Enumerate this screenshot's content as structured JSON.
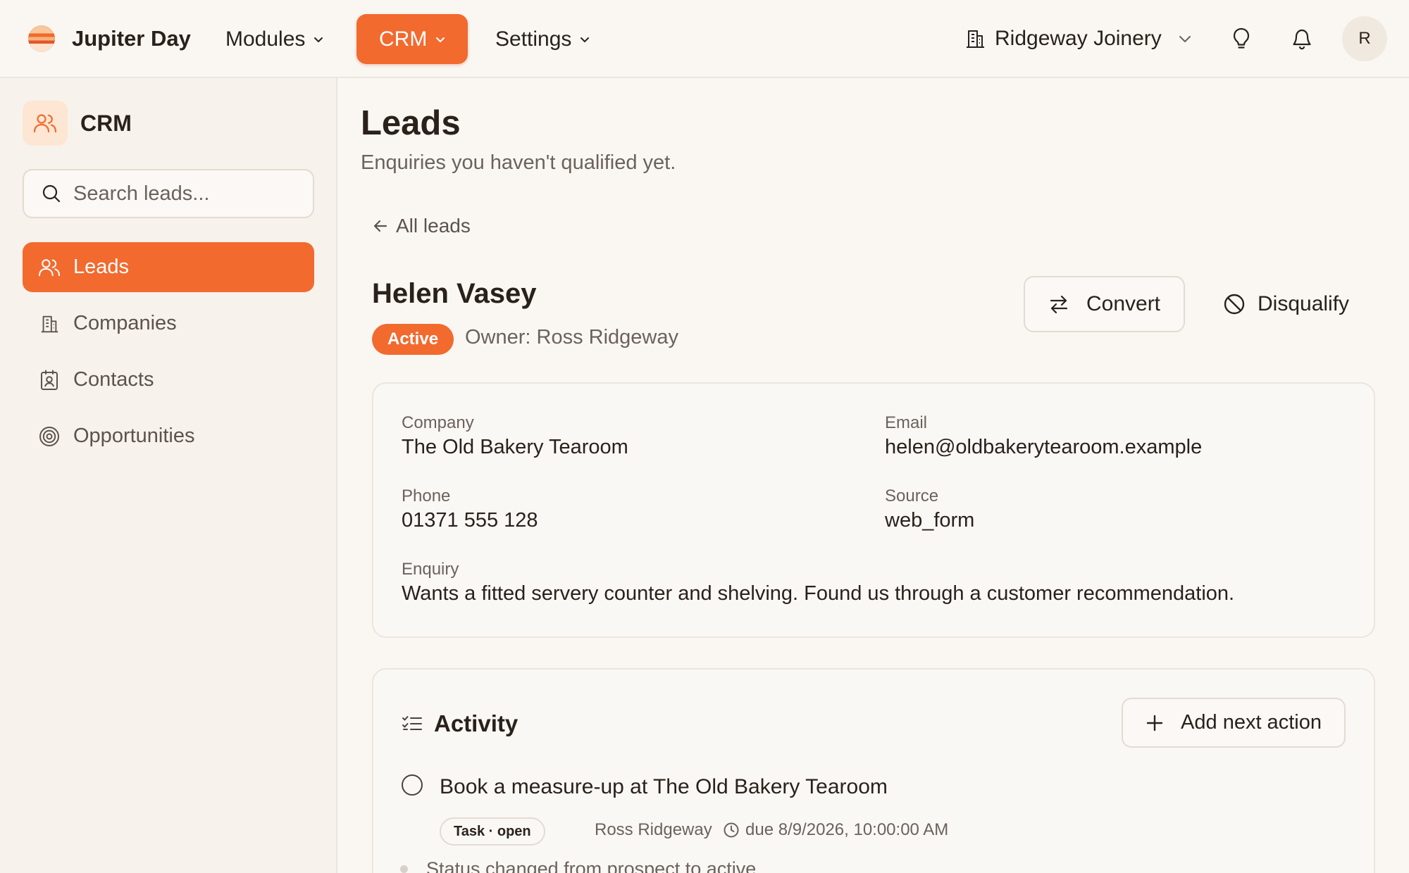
{
  "topbar": {
    "brand_name": "Jupiter Day",
    "nav": {
      "modules": "Modules",
      "crm": "CRM",
      "settings": "Settings"
    },
    "workspace": "Ridgeway Joinery",
    "avatar_initial": "R"
  },
  "sidebar": {
    "title": "CRM",
    "search_placeholder": "Search leads...",
    "items": [
      {
        "label": "Leads",
        "icon": "users-icon",
        "active": true
      },
      {
        "label": "Companies",
        "icon": "building-icon",
        "active": false
      },
      {
        "label": "Contacts",
        "icon": "contact-card-icon",
        "active": false
      },
      {
        "label": "Opportunities",
        "icon": "target-icon",
        "active": false
      }
    ]
  },
  "page": {
    "title": "Leads",
    "subtitle": "Enquiries you haven't qualified yet.",
    "back_label": "All leads"
  },
  "lead": {
    "name": "Helen Vasey",
    "status": "Active",
    "owner": "Owner: Ross Ridgeway",
    "actions": {
      "convert": "Convert",
      "disqualify": "Disqualify"
    },
    "fields": {
      "company_label": "Company",
      "company": "The Old Bakery Tearoom",
      "email_label": "Email",
      "email": "helen@oldbakerytearoom.example",
      "phone_label": "Phone",
      "phone": "01371 555 128",
      "source_label": "Source",
      "source": "web_form",
      "enquiry_label": "Enquiry",
      "enquiry": "Wants a fitted servery counter and shelving. Found us through a customer recommendation."
    }
  },
  "activity": {
    "title": "Activity",
    "add_label": "Add next action",
    "task": {
      "title": "Book a measure-up at The Old Bakery Tearoom",
      "type": "Task · open",
      "owner": "Ross Ridgeway",
      "due": "due 8/9/2026, 10:00:00 AM"
    },
    "status_change": "Status changed from prospect to active"
  },
  "colors": {
    "accent": "#f26a2e",
    "background": "#faf7f3",
    "sidebar": "#f7f2ec",
    "text": "#2a211b",
    "muted": "#6b625b"
  }
}
